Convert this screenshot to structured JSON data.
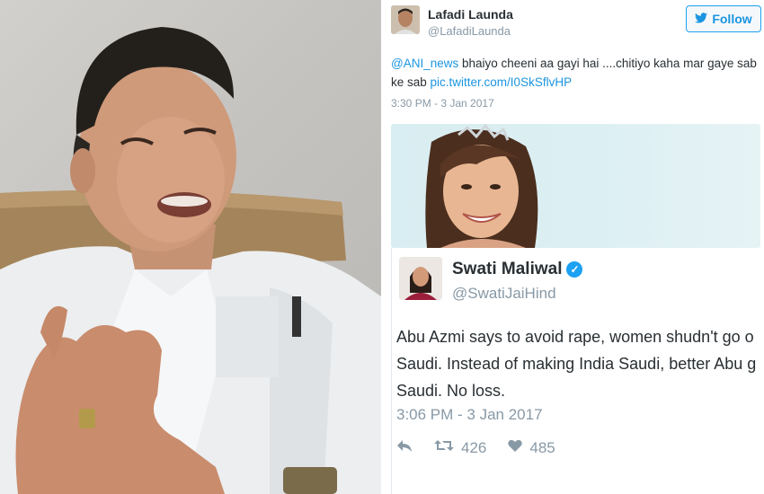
{
  "tweet1": {
    "name": "Lafadi Launda",
    "handle": "@LafadiLaunda",
    "follow_label": "Follow",
    "mention": "@ANI_news",
    "text": " bhaiyo cheeni aa gayi hai ....chitiyo kaha mar gaye sab ke sab ",
    "link": "pic.twitter.com/I0SkSflvHP",
    "timestamp": "3:30 PM - 3 Jan 2017"
  },
  "tweet2": {
    "name": "Swati Maliwal",
    "handle": "@SwatiJaiHind",
    "text_line1": "Abu Azmi says to avoid rape, women shudn't go o",
    "text_line2": "Saudi. Instead of making India Saudi, better Abu g",
    "text_line3": "Saudi. No loss.",
    "timestamp": "3:06 PM - 3 Jan 2017",
    "retweets": "426",
    "likes": "485"
  },
  "icons": {
    "follow": "twitter-bird-icon",
    "verified": "verified-badge-icon",
    "reply": "reply-icon",
    "retweet": "retweet-icon",
    "like": "heart-icon"
  },
  "colors": {
    "link": "#1b95e0",
    "muted": "#8899a6",
    "text": "#292f33",
    "verified": "#1da1f2"
  }
}
